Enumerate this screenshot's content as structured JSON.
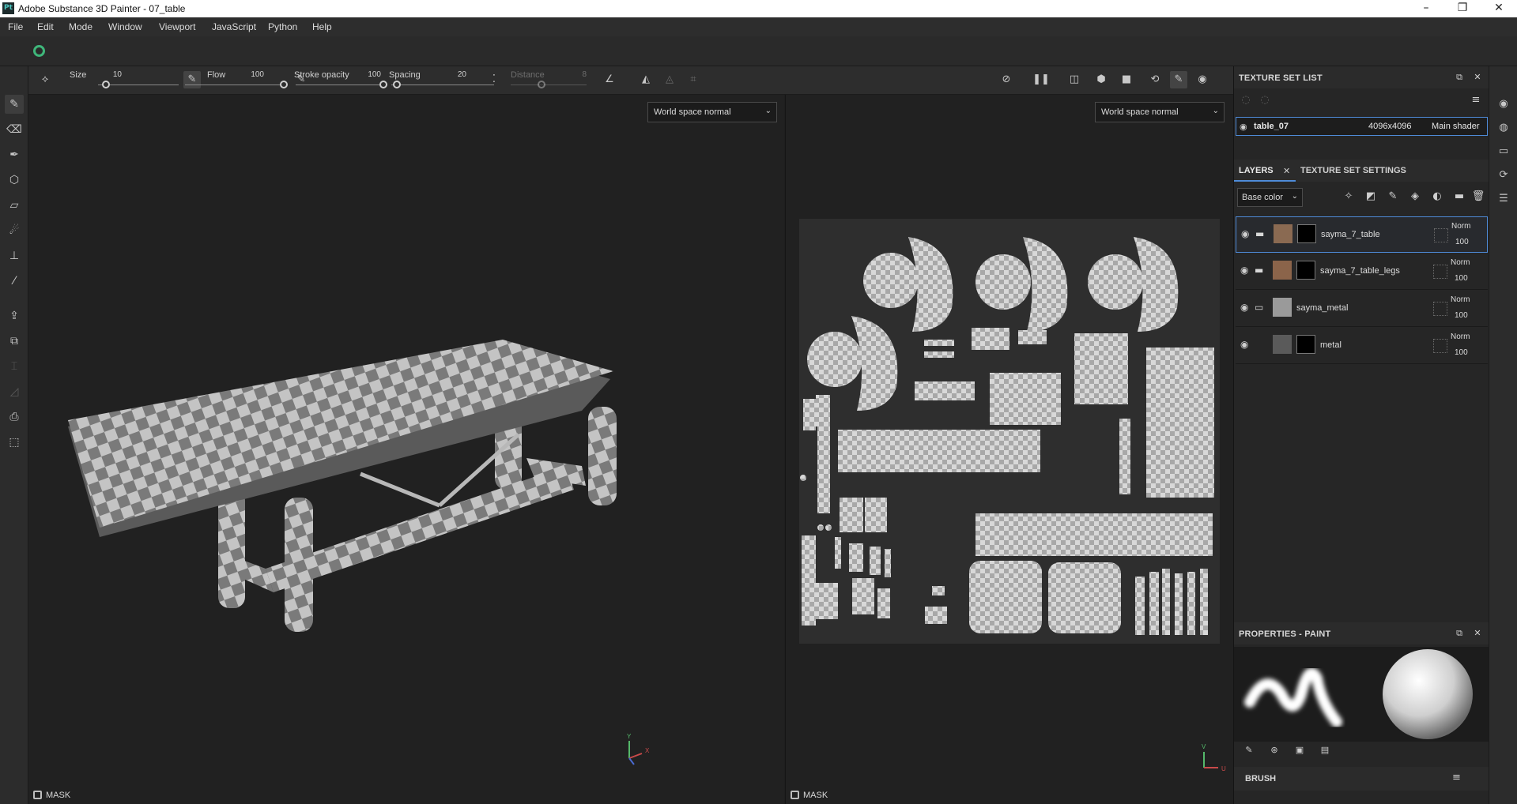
{
  "window": {
    "app_badge": "Pt",
    "title": "Adobe Substance 3D Painter - 07_table",
    "controls": {
      "minimize": "–",
      "maximize": "❐",
      "close": "✕"
    }
  },
  "menu": [
    "File",
    "Edit",
    "Mode",
    "Window",
    "Viewport",
    "JavaScript",
    "Python",
    "Help"
  ],
  "toolbar": {
    "size": {
      "label": "Size",
      "value": "10",
      "level": 0.05
    },
    "flow": {
      "label": "Flow",
      "value": "100",
      "level": 1.0
    },
    "stroke_opacity": {
      "label": "Stroke opacity",
      "value": "100",
      "level": 1.0
    },
    "spacing": {
      "label": "Spacing",
      "value": "20",
      "level": 0.02
    },
    "distance": {
      "label": "Distance",
      "value": "8",
      "level": 0.4
    }
  },
  "viewport3d": {
    "mode_select": "World space normal",
    "mask_label": "MASK",
    "axis_labels": {
      "y": "Y",
      "x": "X"
    }
  },
  "viewport2d": {
    "mode_select": "World space normal",
    "mask_label": "MASK",
    "axis_labels": {
      "v": "V",
      "u": "U"
    }
  },
  "texture_set_list": {
    "title": "TEXTURE SET LIST",
    "row": {
      "name": "table_07",
      "resolution": "4096x4096",
      "shader": "Main shader"
    }
  },
  "layers_panel": {
    "tabs": [
      "LAYERS",
      "TEXTURE SET SETTINGS"
    ],
    "channel": "Base color",
    "layers": [
      {
        "name": "sayma_7_table",
        "blend": "Norm",
        "opacity": "100",
        "selected": true,
        "thumb_color": "#8a6a52"
      },
      {
        "name": "sayma_7_table_legs",
        "blend": "Norm",
        "opacity": "100",
        "selected": false,
        "thumb_color": "#8b644a"
      },
      {
        "name": "sayma_metal",
        "blend": "Norm",
        "opacity": "100",
        "selected": false,
        "thumb_color": "#9a9a9a"
      },
      {
        "name": "metal",
        "blend": "Norm",
        "opacity": "100",
        "selected": false,
        "thumb_color": "#5a5a5a"
      }
    ]
  },
  "properties": {
    "title": "PROPERTIES - PAINT",
    "brush_section": "BRUSH"
  },
  "colors": {
    "accent": "#4e8bd8",
    "session": "#3fb67a",
    "checker_light": "#c4c4c4",
    "checker_dark": "#7a7a7a"
  }
}
